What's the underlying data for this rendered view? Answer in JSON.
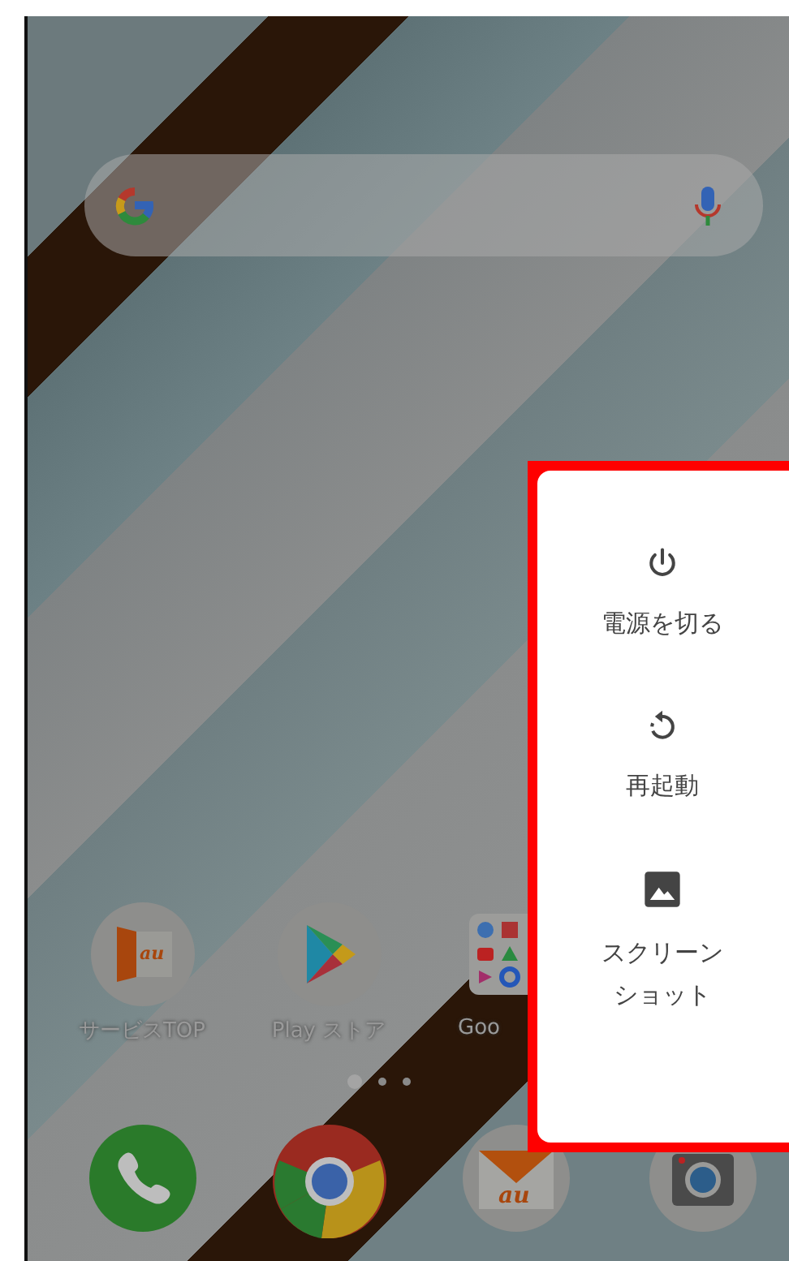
{
  "apps": [
    {
      "label": "サービスTOP",
      "kind": "door",
      "logo_text": "au"
    },
    {
      "label": "Play ストア",
      "kind": "play"
    },
    {
      "label": "Goo",
      "kind": "folder"
    }
  ],
  "page_dots": [
    {
      "selected": true
    },
    {
      "selected": false
    },
    {
      "selected": false
    }
  ],
  "dock": [
    {
      "kind": "phone"
    },
    {
      "kind": "browser"
    },
    {
      "kind": "mail",
      "logo_text": "au"
    },
    {
      "kind": "camera"
    }
  ],
  "power_menu": {
    "items": [
      {
        "label": "電源を切る",
        "kind": "power"
      },
      {
        "label": "再起動",
        "kind": "restart"
      },
      {
        "label": "スクリーンショット",
        "kind": "screenshot"
      }
    ]
  }
}
